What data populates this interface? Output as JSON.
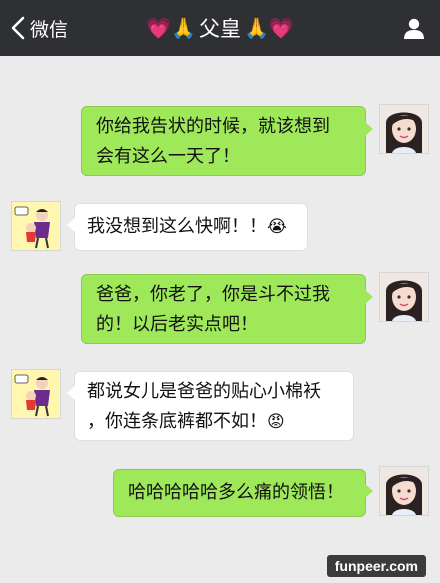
{
  "header": {
    "back_label": "微信",
    "title_prefix": "💗🙏",
    "title": "父皇",
    "title_suffix": "🙏💗",
    "user_icon": "person-icon"
  },
  "messages": [
    {
      "sender": "me",
      "lines": [
        "你给我告状的时候，就该想到",
        "会有这么一天了！"
      ]
    },
    {
      "sender": "dad",
      "lines": [
        "我没想到这么快啊！！"
      ],
      "emoji": "😭"
    },
    {
      "sender": "me",
      "lines": [
        "爸爸，你老了，你是斗不过我",
        "的！以后老实点吧！"
      ]
    },
    {
      "sender": "dad",
      "lines": [
        "都说女儿是爸爸的贴心小棉袄",
        "，你连条底裤都不如！"
      ],
      "emoji": "😡"
    },
    {
      "sender": "me",
      "lines": [
        "哈哈哈哈哈多么痛的领悟！"
      ]
    }
  ],
  "watermark": "funpeer.com",
  "colors": {
    "topbar": "#2f3034",
    "background": "#ebebeb",
    "my_bubble": "#9ee85a",
    "their_bubble": "#ffffff"
  }
}
